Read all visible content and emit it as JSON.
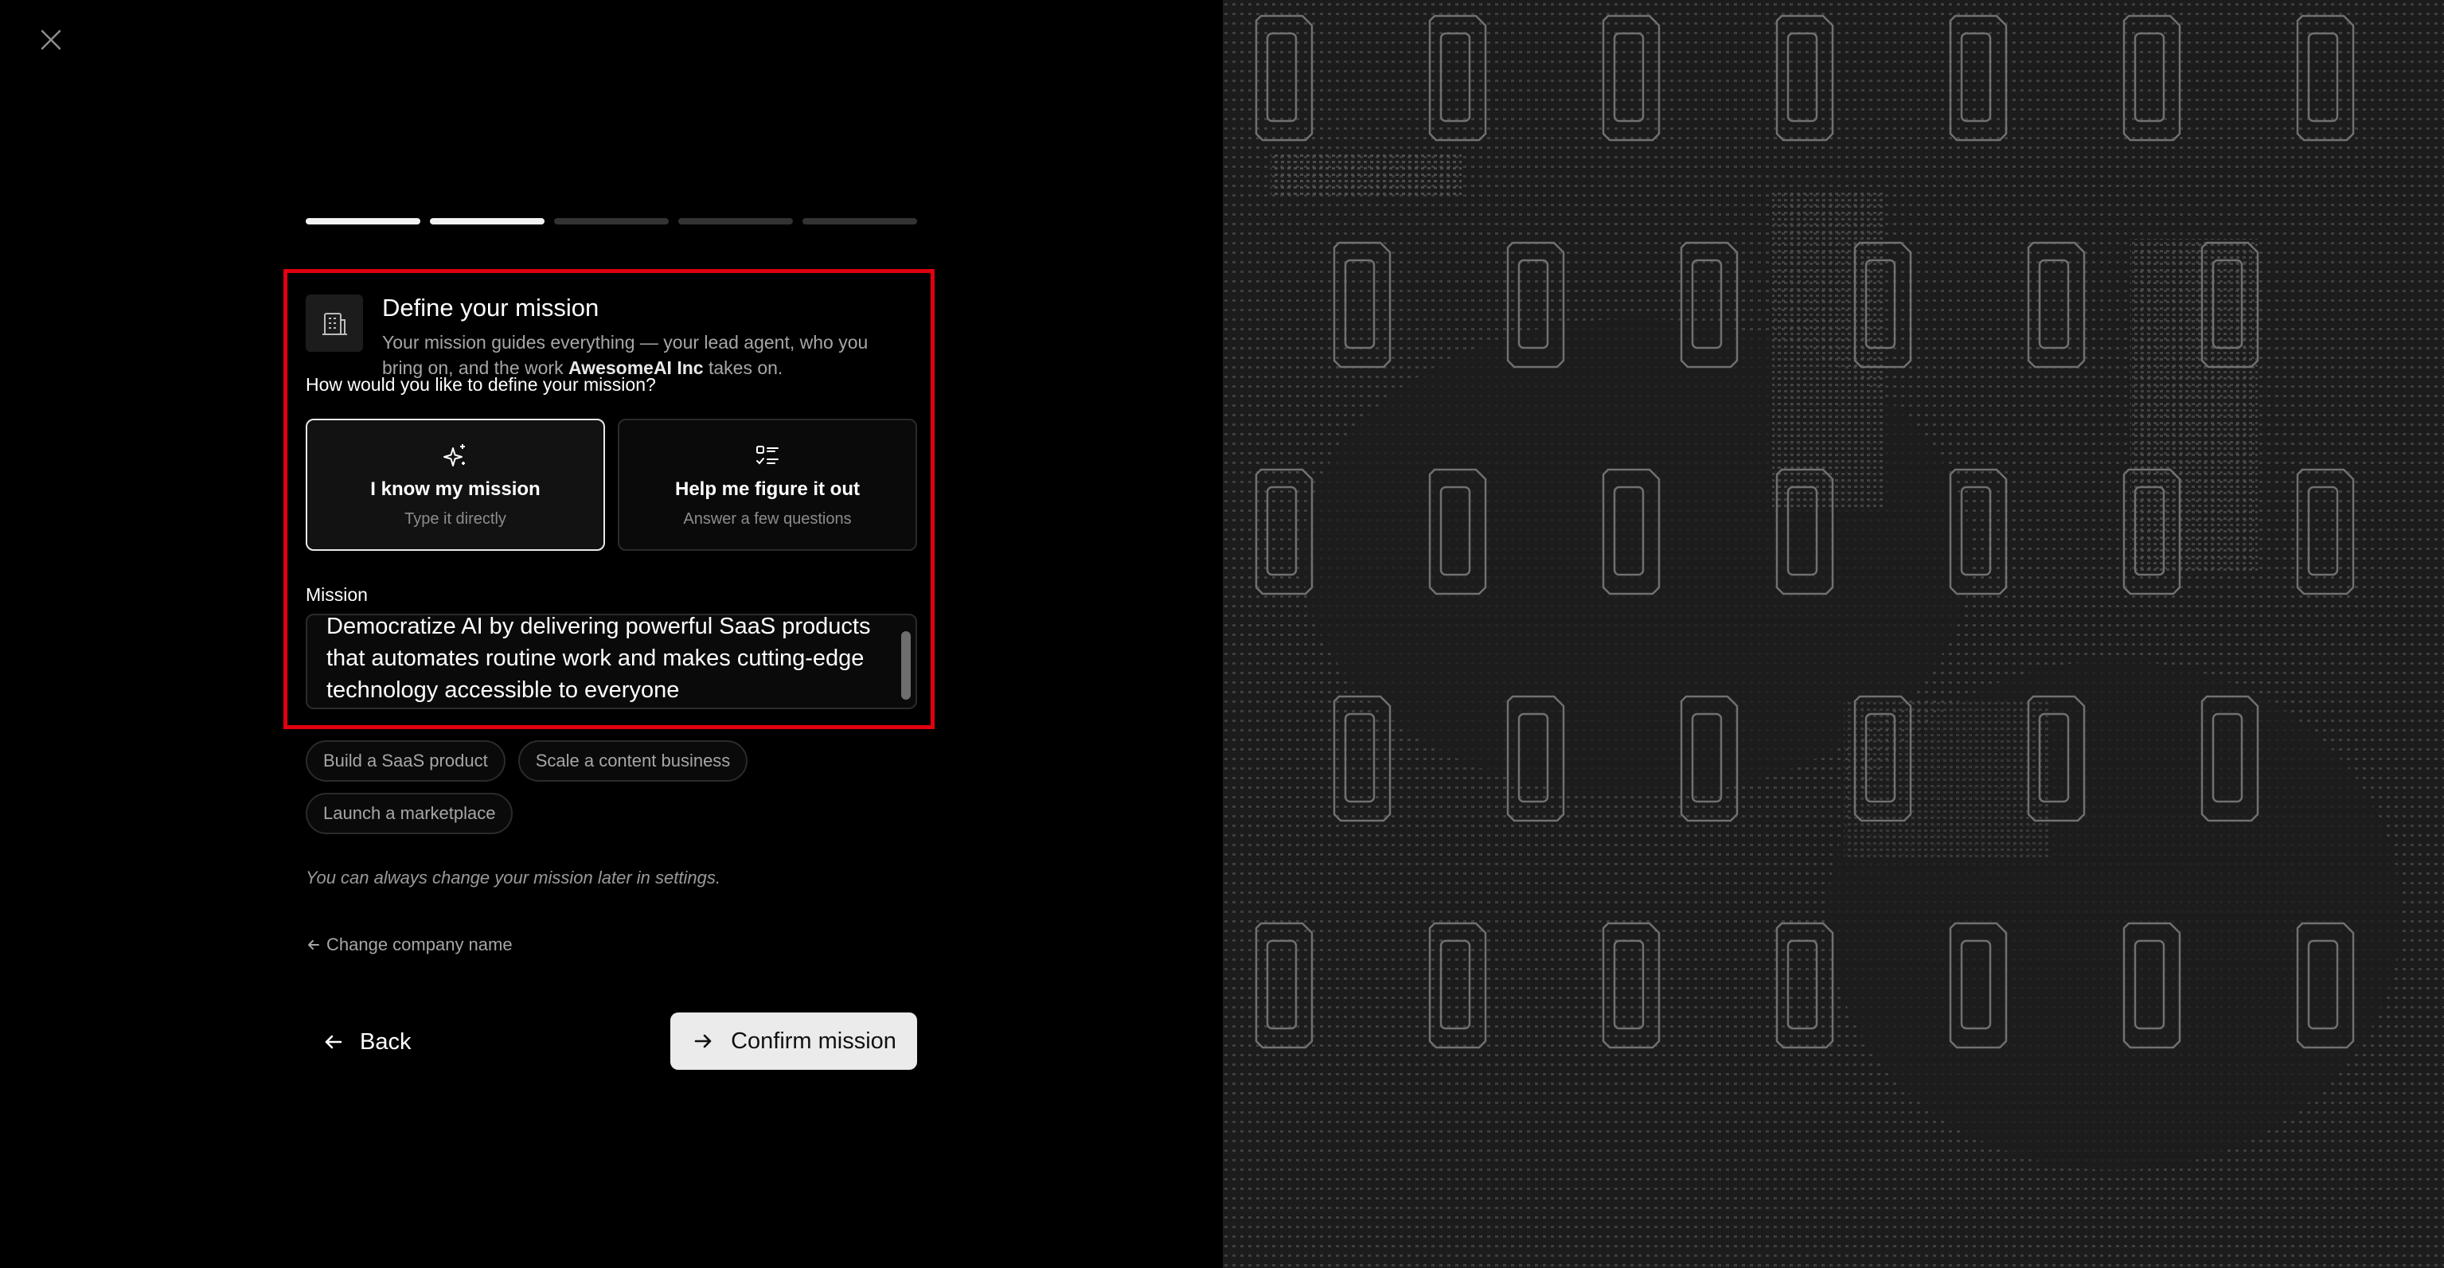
{
  "dialog": {
    "close_icon": "close-icon",
    "progress": {
      "steps_total": 5,
      "steps_completed": 2
    }
  },
  "mission_step": {
    "title": "Define your mission",
    "subtitle_lead": "Your mission guides everything — your lead agent, who you bring on, and the work",
    "company_name": "AwesomeAI Inc",
    "subtitle_tail": "takes on.",
    "question": "How would you like to define your mission?",
    "options": [
      {
        "label": "I know my mission",
        "sublabel": "Type it directly",
        "icon": "sparkles-icon",
        "selected": true
      },
      {
        "label": "Help me figure it out",
        "sublabel": "Answer a few questions",
        "icon": "checklist-icon",
        "selected": false
      }
    ],
    "mission_label": "Mission",
    "mission_value": "Democratize AI by delivering powerful SaaS products that automates routine work and makes cutting-edge technology accessible to everyone",
    "suggestions": [
      "Build a SaaS product",
      "Scale a content business",
      "Launch a marketplace"
    ],
    "note": "You can always change your mission later in settings.",
    "change_company_link": "Change company name",
    "back_label": "Back",
    "confirm_label": "Confirm mission"
  },
  "colors": {
    "highlight": "#e0000f",
    "page_background": "#000000",
    "art_background": "#1c1c1c",
    "primary_button": "#ebebeb"
  }
}
